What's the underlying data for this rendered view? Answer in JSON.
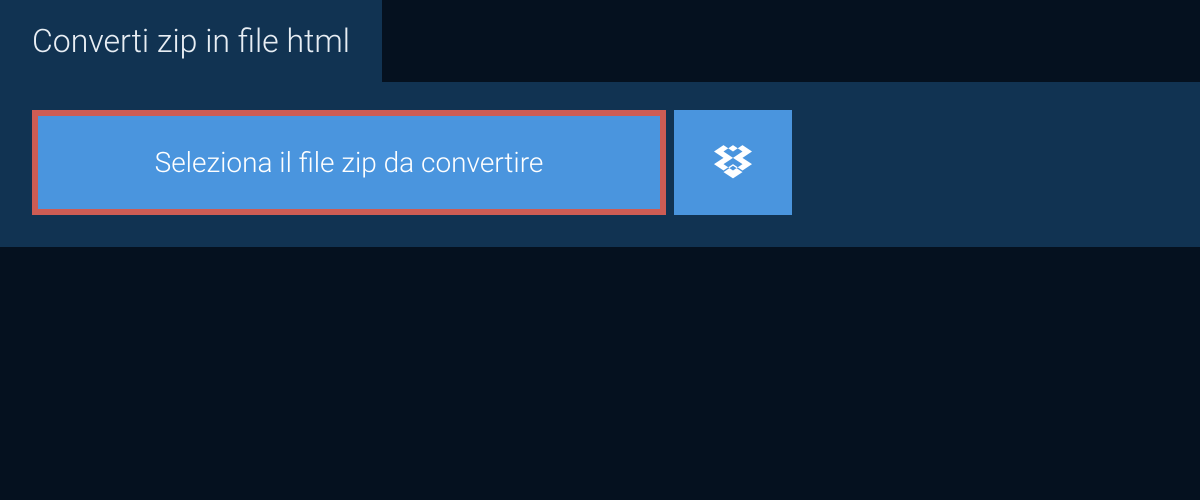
{
  "tab": {
    "title": "Converti zip in file html"
  },
  "actions": {
    "select_file_label": "Seleziona il file zip da convertire",
    "dropbox_icon_name": "dropbox-icon"
  },
  "colors": {
    "background": "#05111f",
    "panel": "#113352",
    "button": "#4a95de",
    "highlight_border": "#cd5c54",
    "text_light": "#e8eef4"
  }
}
